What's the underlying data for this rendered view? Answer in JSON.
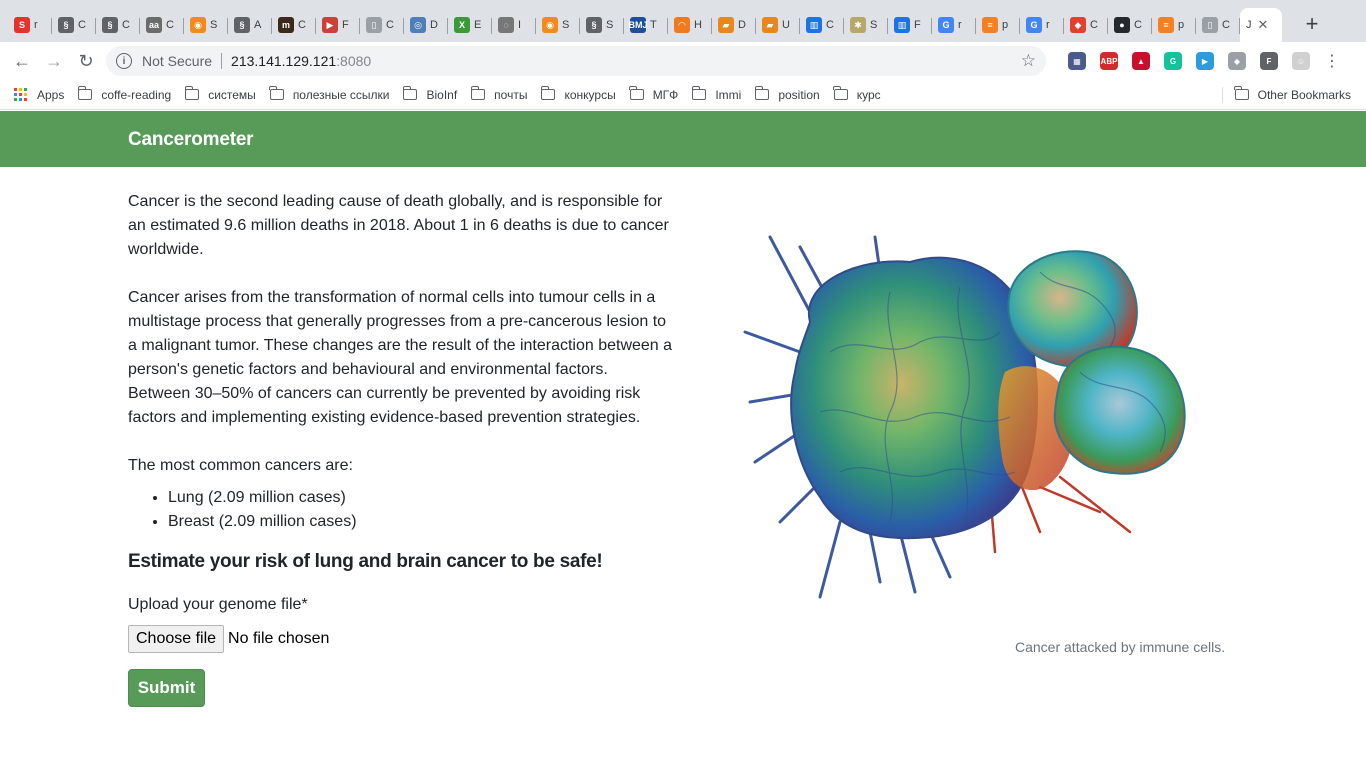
{
  "browser": {
    "tabs": [
      {
        "glyph": "S",
        "text": "r",
        "color": "#e8312f"
      },
      {
        "glyph": "§",
        "text": "C",
        "color": "#5f6368"
      },
      {
        "glyph": "§",
        "text": "C",
        "color": "#5f6368"
      },
      {
        "glyph": "aa",
        "text": "C",
        "color": "#6b6b6b"
      },
      {
        "glyph": "◉",
        "text": "S",
        "color": "#f28b1d"
      },
      {
        "glyph": "§",
        "text": "A",
        "color": "#5f6368"
      },
      {
        "glyph": "m",
        "text": "C",
        "color": "#3b2a1a"
      },
      {
        "glyph": "▶",
        "text": "F",
        "color": "#c9413a"
      },
      {
        "glyph": "▯",
        "text": "C",
        "color": "#9aa0a6"
      },
      {
        "glyph": "◎",
        "text": "D",
        "color": "#4e7fb8"
      },
      {
        "glyph": "X",
        "text": "E",
        "color": "#3a9a3a"
      },
      {
        "glyph": "◌",
        "text": "I",
        "color": "#777777"
      },
      {
        "glyph": "◉",
        "text": "S",
        "color": "#f28b1d"
      },
      {
        "glyph": "§",
        "text": "S",
        "color": "#5f6368"
      },
      {
        "glyph": "BMJ",
        "text": "T",
        "color": "#1e4f9c"
      },
      {
        "glyph": "◠",
        "text": "H",
        "color": "#f07a1f"
      },
      {
        "glyph": "▰",
        "text": "D",
        "color": "#e8871e"
      },
      {
        "glyph": "▰",
        "text": "U",
        "color": "#e8871e"
      },
      {
        "glyph": "▥",
        "text": "C",
        "color": "#1a73e8"
      },
      {
        "glyph": "✱",
        "text": "S",
        "color": "#b7a76b"
      },
      {
        "glyph": "▥",
        "text": "F",
        "color": "#1a73e8"
      },
      {
        "glyph": "G",
        "text": "r",
        "color": "#4285f4"
      },
      {
        "glyph": "≡",
        "text": "p",
        "color": "#f48024"
      },
      {
        "glyph": "G",
        "text": "r",
        "color": "#4285f4"
      },
      {
        "glyph": "◆",
        "text": "C",
        "color": "#e0412f"
      },
      {
        "glyph": "●",
        "text": "C",
        "color": "#24292e"
      },
      {
        "glyph": "≡",
        "text": "p",
        "color": "#f48024"
      },
      {
        "glyph": "▯",
        "text": "C",
        "color": "#9aa0a6"
      },
      {
        "glyph": "",
        "text": "J",
        "color": "#ffffff",
        "active": true
      }
    ],
    "new_tab_label": "+",
    "close_glyph": "✕",
    "back_glyph": "←",
    "forward_glyph": "→",
    "reload_glyph": "↻",
    "info_glyph": "i",
    "security_text": "Not Secure",
    "url_host": "213.141.129.121",
    "url_port": ":8080",
    "star_glyph": "☆",
    "extensions": [
      {
        "name": "ext-icon-1",
        "glyph": "▦",
        "color": "#4a5b8c"
      },
      {
        "name": "adblock-icon",
        "glyph": "ABP",
        "color": "#d22b2b"
      },
      {
        "name": "ext-icon-3",
        "glyph": "▲",
        "color": "#c8102e"
      },
      {
        "name": "grammarly-icon",
        "glyph": "G",
        "color": "#15c39a"
      },
      {
        "name": "ext-icon-5",
        "glyph": "▶",
        "color": "#2d9cdb"
      },
      {
        "name": "dropbox-icon",
        "glyph": "◆",
        "color": "#9aa0a6"
      },
      {
        "name": "ext-icon-7",
        "glyph": "F",
        "color": "#5f6368"
      },
      {
        "name": "profile-icon",
        "glyph": "☺",
        "color": "#d0d0d0"
      }
    ],
    "menu_glyph": "⋮",
    "bookmarks": [
      {
        "label": "Apps",
        "type": "apps"
      },
      {
        "label": "coffe-reading",
        "type": "folder"
      },
      {
        "label": "системы",
        "type": "folder"
      },
      {
        "label": "полезные ссылки",
        "type": "folder"
      },
      {
        "label": "BioInf",
        "type": "folder"
      },
      {
        "label": "почты",
        "type": "folder"
      },
      {
        "label": "конкурсы",
        "type": "folder"
      },
      {
        "label": "МГФ",
        "type": "folder"
      },
      {
        "label": "Immi",
        "type": "folder"
      },
      {
        "label": "position",
        "type": "folder"
      },
      {
        "label": "курс",
        "type": "folder"
      }
    ],
    "other_bookmarks": "Other Bookmarks"
  },
  "page": {
    "brand": "Cancerometer",
    "intro_1": "Cancer is the second leading cause of death globally, and is responsible for an estimated 9.6 million deaths in 2018. About 1 in 6 deaths is due to cancer worldwide.",
    "intro_2": "Cancer arises from the transformation of normal cells into tumour cells in a multistage process that generally progresses from a pre-cancerous lesion to a malignant tumor. These changes are the result of the interaction between a person's genetic factors and behavioural and environmental factors. Between 30–50% of cancers can currently be prevented by avoiding risk factors and implementing existing evidence-based prevention strategies.",
    "common_intro": "The most common cancers are:",
    "common_list": [
      "Lung (2.09 million cases)",
      "Breast (2.09 million cases)"
    ],
    "form_heading": "Estimate your risk of lung and brain cancer to be safe!",
    "upload_label": "Upload your genome file",
    "required_mark": "*",
    "choose_file_label": "Choose file",
    "file_status": "No file chosen",
    "submit_label": "Submit",
    "caption": "Cancer attacked by immune cells."
  },
  "colors": {
    "navbar": "#589a58",
    "submit": "#589a58",
    "caption": "#6c757d"
  }
}
